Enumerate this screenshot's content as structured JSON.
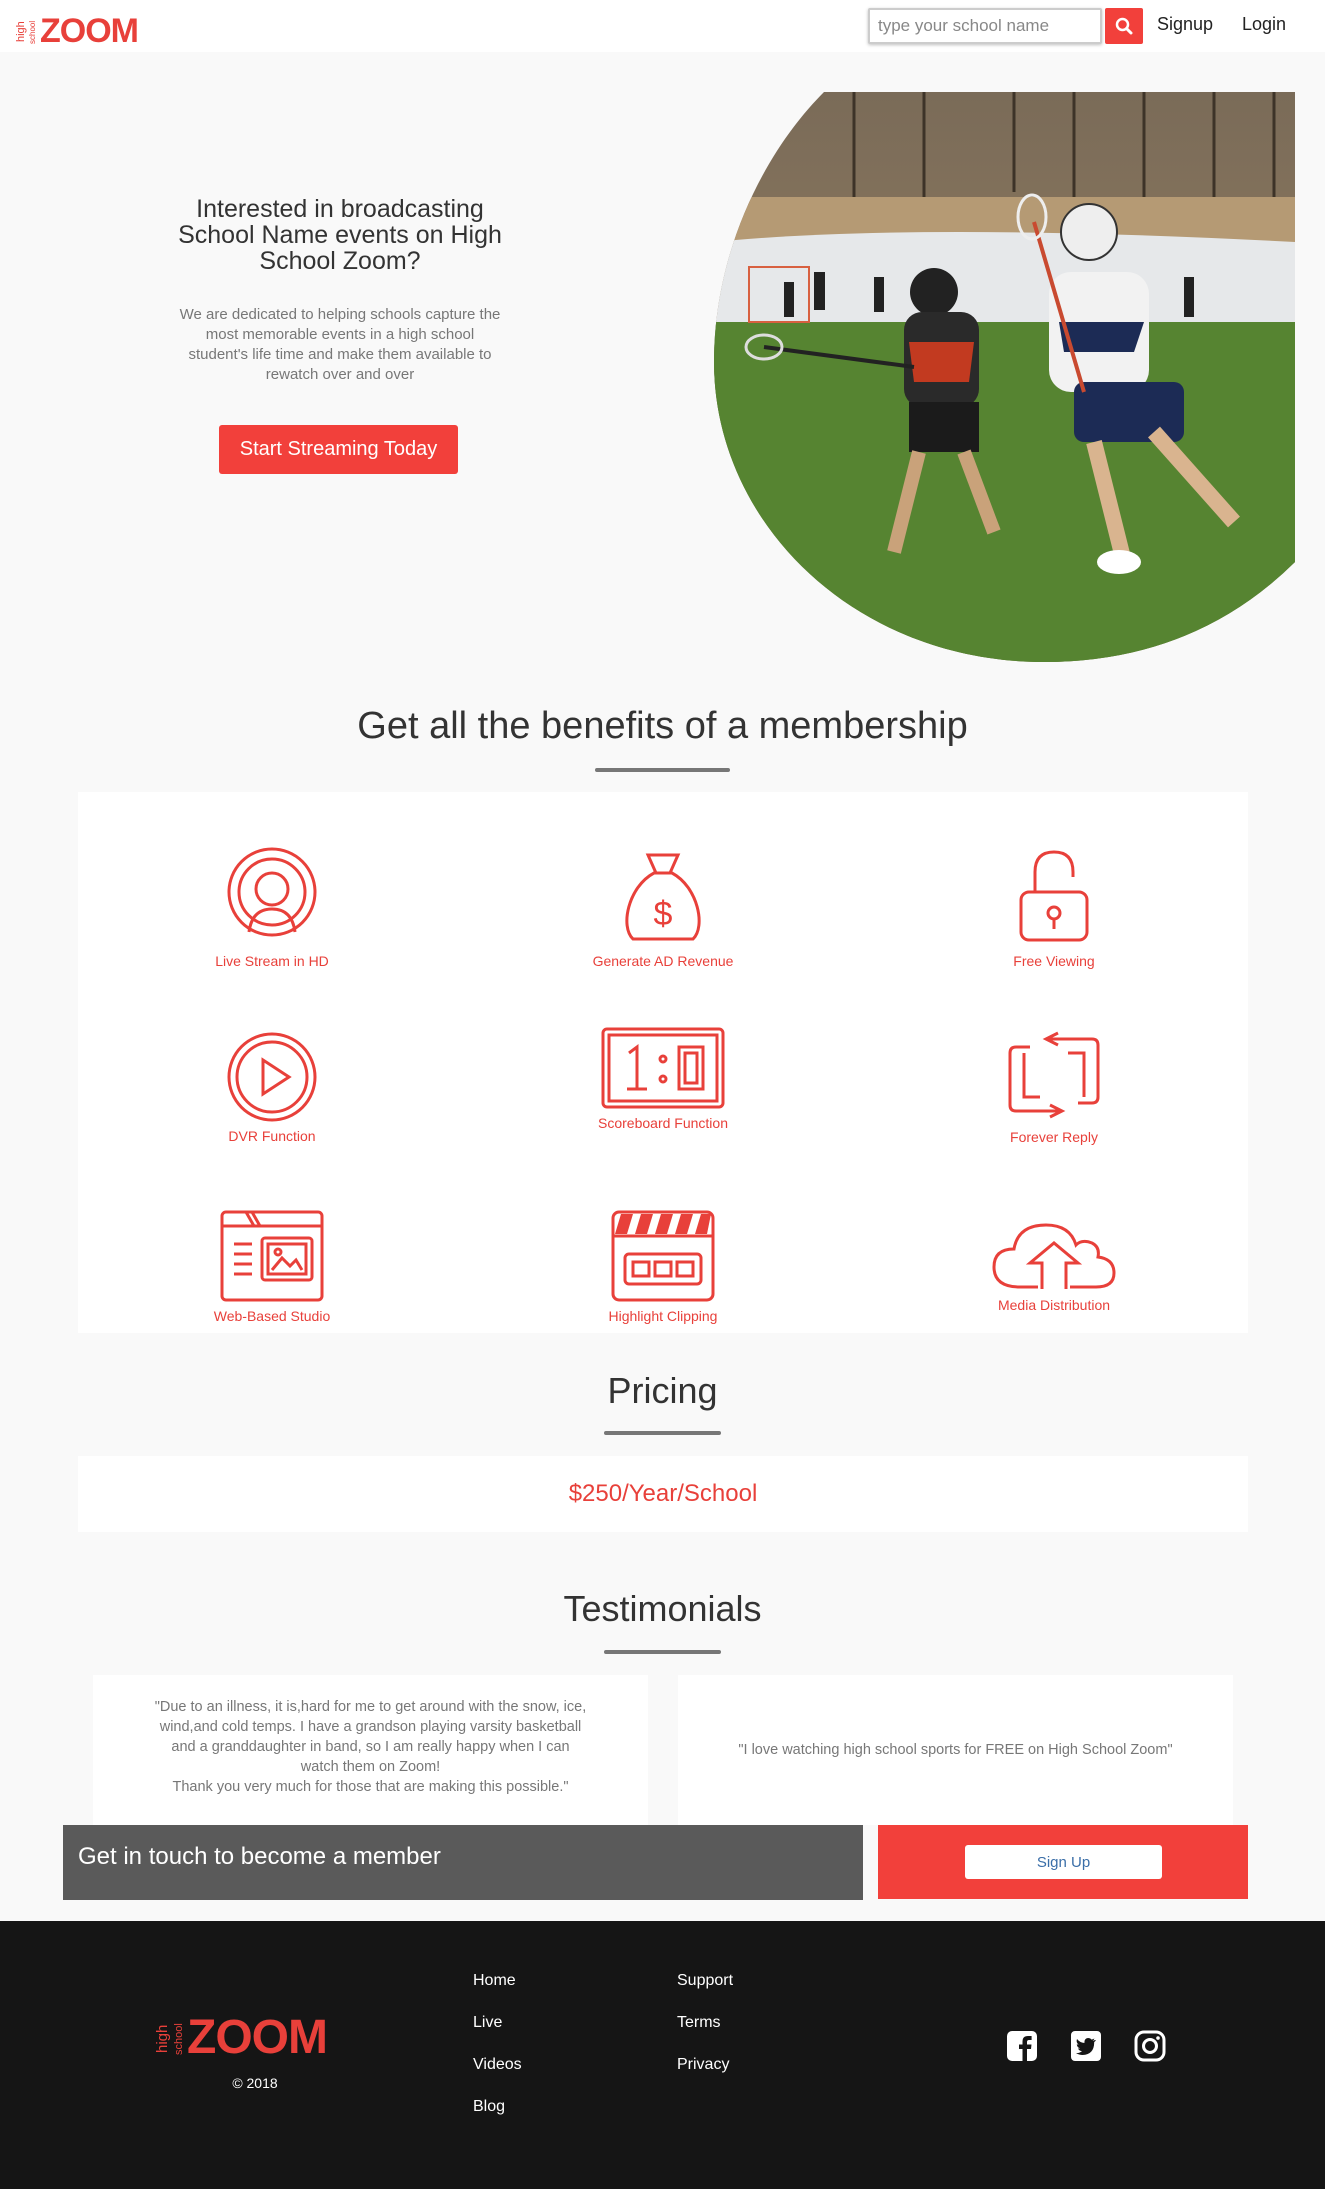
{
  "brand": {
    "logo_small_top": "high",
    "logo_small_bottom": "school",
    "logo_text": "ZOOM",
    "accent_color": "#f2403b"
  },
  "header": {
    "search_placeholder": "type your school name",
    "search_icon": "search-icon",
    "signup_label": "Signup",
    "login_label": "Login"
  },
  "hero": {
    "title": "Interested in broadcasting School Name events on High School Zoom?",
    "description": "We are dedicated to helping schools capture the most memorable events in a high school student's life time and make them available to rewatch over and over",
    "cta_label": "Start Streaming Today",
    "image": "lacrosse-players-photo"
  },
  "benefits": {
    "title": "Get all the benefits of a membership",
    "items": [
      {
        "label": "Live Stream in HD",
        "icon": "live-stream-icon"
      },
      {
        "label": "Generate AD Revenue",
        "icon": "money-bag-icon"
      },
      {
        "label": "Free Viewing",
        "icon": "unlocked-padlock-icon"
      },
      {
        "label": "DVR Function",
        "icon": "play-circle-icon"
      },
      {
        "label": "Scoreboard Function",
        "icon": "scoreboard-icon"
      },
      {
        "label": "Forever Reply",
        "icon": "repeat-icon"
      },
      {
        "label": "Web-Based Studio",
        "icon": "browser-studio-icon"
      },
      {
        "label": "Highlight Clipping",
        "icon": "clapperboard-icon"
      },
      {
        "label": "Media Distribution",
        "icon": "cloud-upload-icon"
      }
    ]
  },
  "pricing": {
    "title": "Pricing",
    "price": "$250/Year/School"
  },
  "testimonials": {
    "title": "Testimonials",
    "items": [
      {
        "quote": "\"Due to an illness, it is,hard for me to get around with the snow, ice, wind,and cold temps. I have a grandson playing varsity basketball and a granddaughter in band, so I am really happy when I can watch them on Zoom!",
        "quote_line2": "Thank you very much for those that are making this possible.\""
      },
      {
        "quote": "\"I love watching high school sports for FREE on High School Zoom\"",
        "quote_line2": ""
      }
    ]
  },
  "cta_band": {
    "text": "Get in touch to become a member",
    "button_label": "Sign Up"
  },
  "footer": {
    "links_col1": [
      "Home",
      "Live",
      "Videos",
      "Blog"
    ],
    "links_col2": [
      "Support",
      "Terms",
      "Privacy"
    ],
    "copyright": "© 2018",
    "social": [
      "facebook-icon",
      "twitter-icon",
      "instagram-icon"
    ]
  }
}
